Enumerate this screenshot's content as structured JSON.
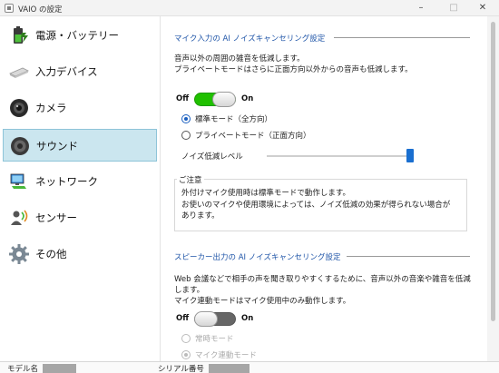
{
  "window": {
    "title": "VAIO の設定"
  },
  "sidebar": {
    "items": [
      {
        "label": "電源・バッテリー",
        "icon": "battery-icon"
      },
      {
        "label": "入力デバイス",
        "icon": "keyboard-icon"
      },
      {
        "label": "カメラ",
        "icon": "camera-icon"
      },
      {
        "label": "サウンド",
        "icon": "speaker-icon",
        "active": true
      },
      {
        "label": "ネットワーク",
        "icon": "network-icon"
      },
      {
        "label": "センサー",
        "icon": "sensor-icon"
      },
      {
        "label": "その他",
        "icon": "gear-icon"
      }
    ]
  },
  "mic": {
    "heading": "マイク入力の AI ノイズキャンセリング設定",
    "desc_1": "音声以外の周囲の雑音を低減します。",
    "desc_2": "プライベートモードはさらに正面方向以外からの音声も低減します。",
    "toggle": {
      "off_label": "Off",
      "on_label": "On",
      "state": "on"
    },
    "standard_mode": "標準モード（全方向）",
    "private_mode": "プライベートモード（正面方向）",
    "selected_mode": "standard",
    "noise_level_label": "ノイズ低減レベル",
    "noise_level": 1.0,
    "notice_title": "ご注意",
    "notice_1": "外付けマイク使用時は標準モードで動作します。",
    "notice_2": "お使いのマイクや使用環境によっては、ノイズ低減の効果が得られない場合が",
    "notice_3": "あります。"
  },
  "speaker": {
    "heading": "スピーカー出力の AI ノイズキャンセリング設定",
    "desc_1": "Web 会議などで相手の声を聞き取りやすくするために、音声以外の音楽や雑音を低減",
    "desc_2": "します。",
    "desc_3": "マイク連動モードはマイク使用中のみ動作します。",
    "toggle": {
      "off_label": "Off",
      "on_label": "On",
      "state": "off"
    },
    "always_mode": "常時モード",
    "mic_linked_mode": "マイク連動モード",
    "selected_mode": "mic_linked"
  },
  "statusbar": {
    "model_label": "モデル名",
    "serial_label": "シリアル番号"
  },
  "colors": {
    "accent": "#1f55a8",
    "toggle_on": "#20c000",
    "selection": "#cbe6ef",
    "slider": "#1a6fd0"
  }
}
